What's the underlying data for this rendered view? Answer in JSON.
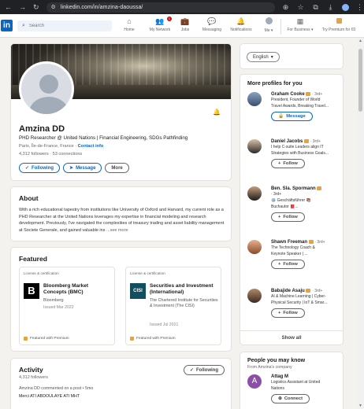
{
  "browser": {
    "url": "linkedin.com/in/amzina-daoussa/"
  },
  "nav": {
    "search_placeholder": "Search",
    "items": [
      {
        "label": "Home",
        "icon": "home-icon"
      },
      {
        "label": "My Network",
        "icon": "network-icon",
        "badge": "1"
      },
      {
        "label": "Jobs",
        "icon": "jobs-icon"
      },
      {
        "label": "Messaging",
        "icon": "messaging-icon"
      },
      {
        "label": "Notifications",
        "icon": "notifications-icon"
      },
      {
        "label": "Me",
        "icon": "me-avatar"
      },
      {
        "label": "For Business",
        "icon": "grid-icon"
      },
      {
        "label": "Try Premium for €0",
        "icon": "premium-icon"
      }
    ]
  },
  "profile": {
    "name": "Amzina DD",
    "headline": "PHD Researcher @ United Nations | Financial Engineering, SDGs Pathfinding",
    "location": "Paris, Île-de-France, France · ",
    "contact_info": "Contact info",
    "stats": "4,312 followers · 53 connections",
    "following_label": "Following",
    "message_label": "Message",
    "more_label": "More"
  },
  "about": {
    "title": "About",
    "text": "With a rich educational tapestry from institutions like University of Oxford and Harvard, my current role as a PHD Researcher at the United Nations leverages my expertise in financial modeling and research development. Previously, I've navigated the complexities of treasury trading and asset liability management at Societe Generale, and gained valuable ins",
    "more": "...see more"
  },
  "featured": {
    "title": "Featured",
    "items": [
      {
        "type": "License & certification",
        "title": "Bloomberg Market Concepts (BMC)",
        "issuer": "Bloomberg",
        "date": "Issued Mar 2022",
        "footer": "Featured with Premium"
      },
      {
        "type": "License & certification",
        "title": "Securities and Investment (International)",
        "issuer": "The Chartered Institute for Securities & Investment (The CISI)",
        "date": "Issued Jul 2021",
        "footer": "Featured with Premium"
      }
    ]
  },
  "activity": {
    "title": "Activity",
    "followers": "4,312 followers",
    "following_label": "Following",
    "line1": "Amzina DD commented on a post • 5mo",
    "line2": "Merci ATI ABDOULAYE ATI MHT"
  },
  "language": {
    "label": "English"
  },
  "more_profiles": {
    "title": "More profiles for you",
    "show_all": "Show all",
    "people": [
      {
        "name": "Graham Cooke",
        "degree": "· 3rd+",
        "desc1": "President, Founder of World",
        "desc2": "Travel Awards, Breaking Travel...",
        "button": "Message"
      },
      {
        "name": "Daniel Jacobs",
        "degree": "· 3rd+",
        "desc1": "I help C-suite Leaders align IT",
        "desc2": "Strategies with Business Goals...",
        "button": "Follow"
      },
      {
        "name": "Ben. Sla. Spormann",
        "degree": "· 3rd+",
        "desc1": "⚙️ Geschäftsführer 📚",
        "desc2": "Buchautor 📕...",
        "button": "Follow"
      },
      {
        "name": "Shawn Freeman",
        "degree": "· 3rd+",
        "desc1": "The Technology Coach &",
        "desc2": "Keynote Speaker | ...",
        "button": "Follow"
      },
      {
        "name": "Babajide Asaju",
        "degree": "· 3rd+",
        "desc1": "AI & Machine Learning | Cyber-",
        "desc2": "Physical Security | IoT & Smar...",
        "button": "Follow"
      }
    ]
  },
  "pymk": {
    "title": "People you may know",
    "subtitle": "From Amzina's company",
    "person": {
      "initial": "A",
      "name": "Attag M",
      "desc1": "Logistics Assistant at United",
      "desc2": "Nations",
      "button": "Connect"
    }
  },
  "colors": {
    "linkedin_blue": "#0a66c2",
    "premium_gold": "#e7a33e",
    "background": "#f4f2ee"
  }
}
